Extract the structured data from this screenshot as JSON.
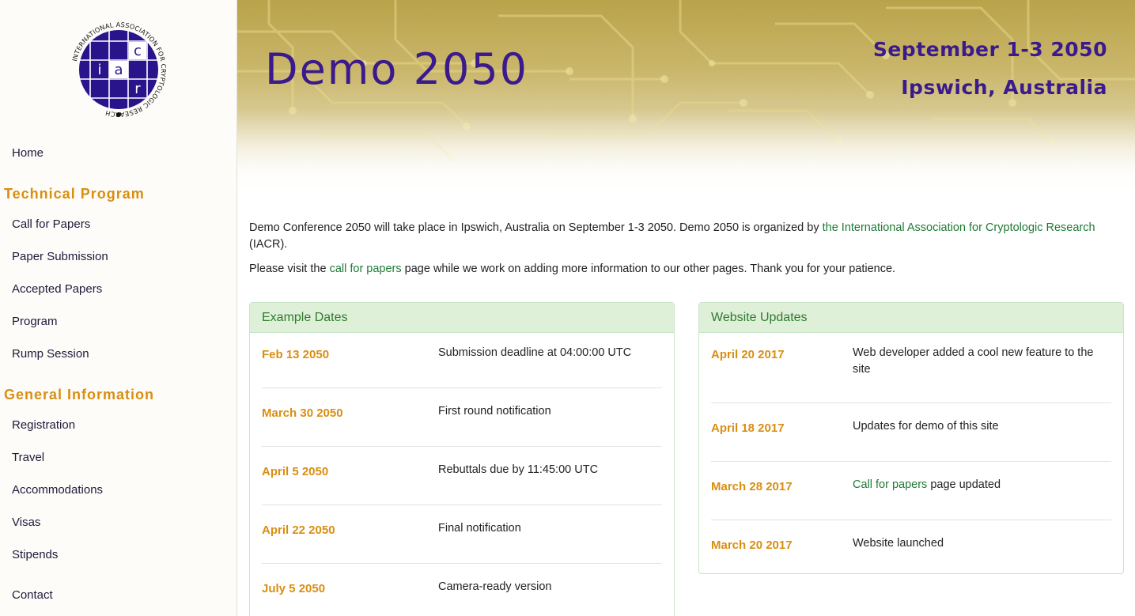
{
  "sidebar": {
    "logo": {
      "ring_text": "INTERNATIONAL ASSOCIATION FOR CRYPTOLOGIC RESEARCH",
      "letters": [
        "i",
        "a",
        "c",
        "r"
      ]
    },
    "home": "Home",
    "technical_heading": "Technical Program",
    "technical_items": [
      "Call for Papers",
      "Paper Submission",
      "Accepted Papers",
      "Program",
      "Rump Session"
    ],
    "general_heading": "General Information",
    "general_items": [
      "Registration",
      "Travel",
      "Accommodations",
      "Visas",
      "Stipends"
    ],
    "contact": "Contact"
  },
  "banner": {
    "title": "Demo 2050",
    "date": "September 1-3 2050",
    "location": "Ipswich, Australia"
  },
  "intro": {
    "p1_before": "Demo Conference 2050 will take place in Ipswich, Australia on September 1-3 2050. Demo 2050 is organized by ",
    "p1_link": "the International Association for Cryptologic Research",
    "p1_after": " (IACR).",
    "p2_before": "Please visit the ",
    "p2_link": "call for papers",
    "p2_after": " page while we work on adding more information to our other pages. Thank you for your patience."
  },
  "dates_panel": {
    "title": "Example Dates",
    "rows": [
      {
        "date": "Feb 13 2050",
        "text": "Submission deadline at 04:00:00 UTC"
      },
      {
        "date": "March 30 2050",
        "text": "First round notification"
      },
      {
        "date": "April 5 2050",
        "text": "Rebuttals due by 11:45:00 UTC"
      },
      {
        "date": "April 22 2050",
        "text": "Final notification"
      },
      {
        "date": "July 5 2050",
        "text": "Camera-ready version"
      }
    ]
  },
  "updates_panel": {
    "title": "Website Updates",
    "rows": [
      {
        "date": "April 20 2017",
        "text": "Web developer added a cool new feature to the site"
      },
      {
        "date": "April 18 2017",
        "text": "Updates for demo of this site"
      },
      {
        "date": "March 28 2017",
        "link": "Call for papers",
        "text": " page updated"
      },
      {
        "date": "March 20 2017",
        "text": "Website launched"
      }
    ]
  },
  "colors": {
    "accent_purple": "#3a1a8c",
    "heading_orange": "#d98e10",
    "link_green": "#1e7a34",
    "panel_header_bg": "#dff0d8"
  }
}
